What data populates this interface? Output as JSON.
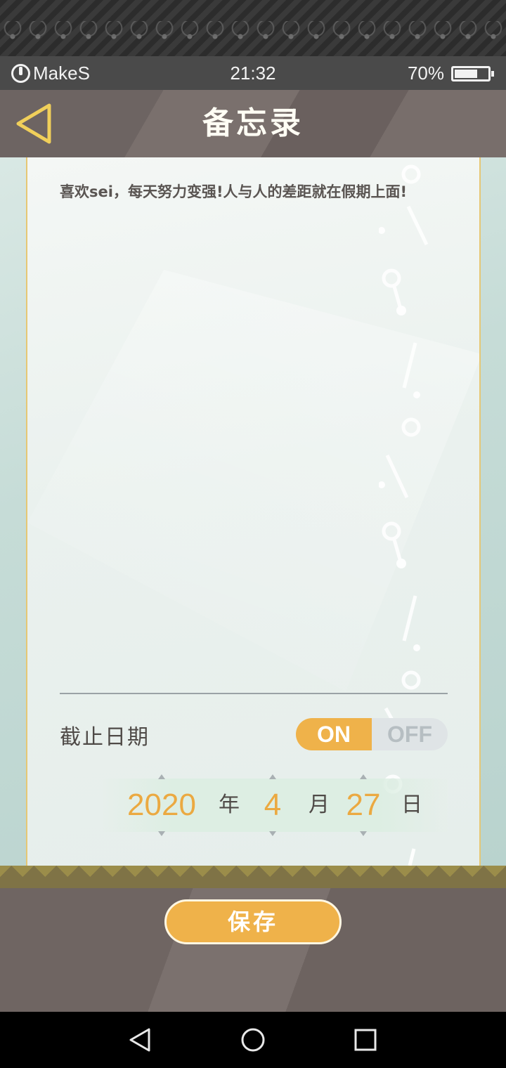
{
  "status_bar": {
    "brand": "MakeS",
    "time": "21:32",
    "battery_percent_text": "70%",
    "battery_level": 0.7
  },
  "header": {
    "title": "备忘录",
    "back_icon": "back-triangle-icon"
  },
  "memo": {
    "text": "喜欢sei，每天努力变强!人与人的差距就在假期上面!"
  },
  "deadline": {
    "label": "截止日期",
    "toggle_on": "ON",
    "toggle_off": "OFF",
    "enabled": true,
    "year": "2020",
    "year_unit": "年",
    "month": "4",
    "month_unit": "月",
    "day": "27",
    "day_unit": "日"
  },
  "footer": {
    "save_label": "保存"
  },
  "colors": {
    "accent": "#efb24a",
    "gold_border": "#e6c774",
    "header_bg": "#6d6462"
  },
  "nav_bar": {
    "icons": [
      "back-icon",
      "home-icon",
      "recents-icon"
    ]
  }
}
